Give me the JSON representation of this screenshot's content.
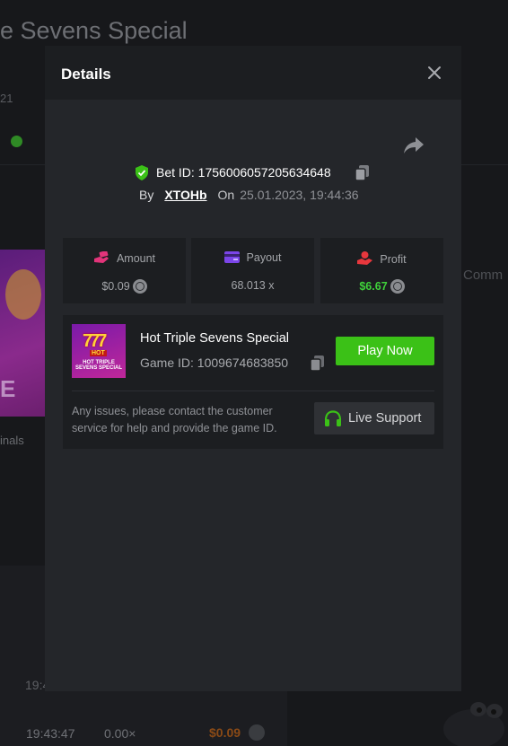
{
  "background": {
    "title_fragment": "e Sevens Special",
    "small_text": "21",
    "finals_text": "inals",
    "comm_text": "Comm",
    "row_a_time": "19:4",
    "row_time": "19:43:47",
    "row_multiplier": "0.00×",
    "row_amount": "$0.09"
  },
  "modal": {
    "title": "Details",
    "bet_id_label": "Bet ID: 1756006057205634648",
    "by_label": "By",
    "username": "XTOHb",
    "on_label": "On",
    "date": "25.01.2023, 19:44:36",
    "stats": {
      "amount": {
        "label": "Amount",
        "value": "$0.09"
      },
      "payout": {
        "label": "Payout",
        "value": "68.013 x"
      },
      "profit": {
        "label": "Profit",
        "value": "$6.67"
      }
    },
    "game": {
      "name": "Hot Triple Sevens Special",
      "game_id": "Game ID: 1009674683850",
      "thumb_hot": "HOT",
      "thumb_title": "HOT TRIPLE SEVENS SPECIAL",
      "play_label": "Play Now"
    },
    "support": {
      "message": "Any issues, please contact the customer service for help and provide the game ID.",
      "button_label": "Live Support"
    }
  },
  "colors": {
    "accent_green": "#3bc117",
    "profit_green": "#3fd13a",
    "amount_pink": "#e2347a",
    "payout_purple": "#7b45e8",
    "profit_red": "#e8373d"
  }
}
